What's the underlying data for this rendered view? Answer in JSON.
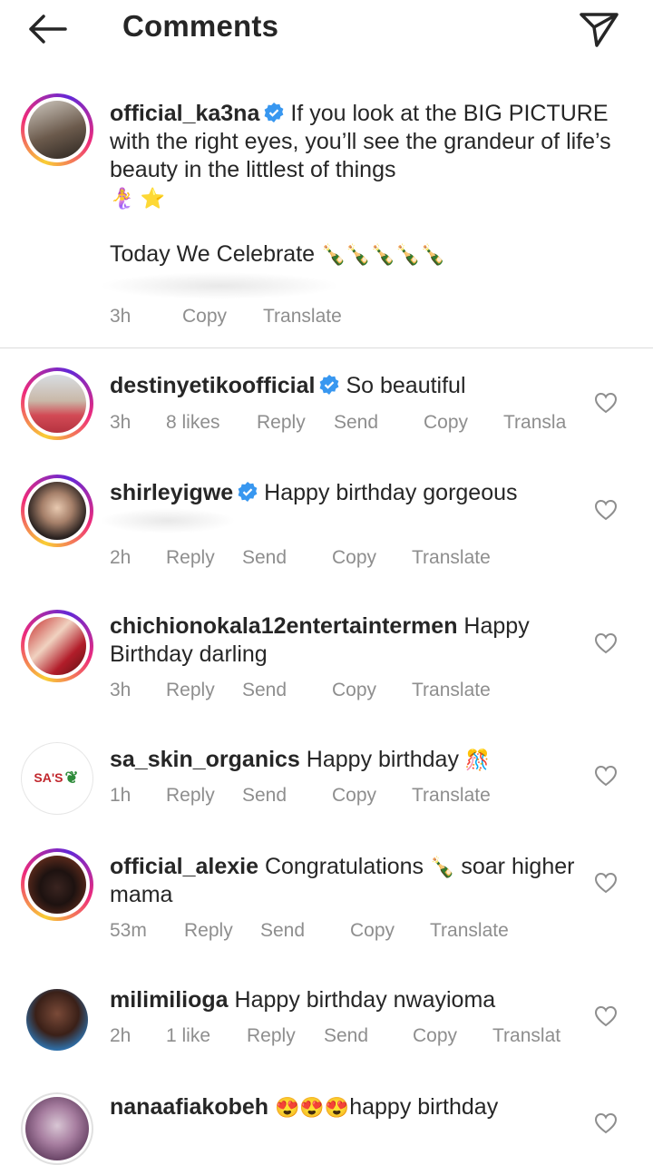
{
  "header": {
    "title": "Comments"
  },
  "caption": {
    "username": "official_ka3na",
    "text_line1": "If you look at the BIG PICTURE with the right eyes, you’ll see the grandeur of life’s beauty in the littlest of things",
    "emoji_line": "🧜‍♀️ ⭐",
    "celebrate": "Today We Celebrate",
    "celebrate_emojis": "🍾🍾🍾🍾🍾",
    "time": "3h",
    "copy": "Copy",
    "translate": "Translate"
  },
  "comments": [
    {
      "username": "destinyetikoofficial",
      "verified": true,
      "text": "So beautiful",
      "time": "3h",
      "likes": "8 likes",
      "reply": "Reply",
      "send": "Send",
      "copy": "Copy",
      "translate": "Transla"
    },
    {
      "username": "shirleyigwe",
      "verified": true,
      "text": "Happy birthday gorgeous",
      "time": "2h",
      "reply": "Reply",
      "send": "Send",
      "copy": "Copy",
      "translate": "Translate"
    },
    {
      "username": "chichionokala12entertaintermen",
      "verified": false,
      "text": "Happy Birthday darling",
      "time": "3h",
      "reply": "Reply",
      "send": "Send",
      "copy": "Copy",
      "translate": "Translate"
    },
    {
      "username": "sa_skin_organics",
      "verified": false,
      "text": "Happy birthday",
      "emoji": "🎊",
      "avatar_text": "SA'S",
      "time": "1h",
      "reply": "Reply",
      "send": "Send",
      "copy": "Copy",
      "translate": "Translate"
    },
    {
      "username": "official_alexie",
      "verified": false,
      "text": "Congratulations",
      "emoji": "🍾",
      "text2": "soar higher mama",
      "time": "53m",
      "reply": "Reply",
      "send": "Send",
      "copy": "Copy",
      "translate": "Translate"
    },
    {
      "username": "milimilioga",
      "verified": false,
      "text": "Happy birthday nwayioma",
      "time": "2h",
      "likes": "1 like",
      "reply": "Reply",
      "send": "Send",
      "copy": "Copy",
      "translate": "Translat"
    },
    {
      "username": "nanaafiakobeh",
      "verified": false,
      "emoji": "😍😍😍",
      "text": "happy birthday"
    }
  ],
  "icons": {
    "back": "arrow-left-icon",
    "send": "paper-plane-icon",
    "verified": "verified-badge-icon",
    "heart": "heart-outline-icon"
  },
  "colors": {
    "verified": "#3897f0",
    "meta": "#8e8e8e",
    "text": "#262626",
    "divider": "#dbdbdb"
  }
}
